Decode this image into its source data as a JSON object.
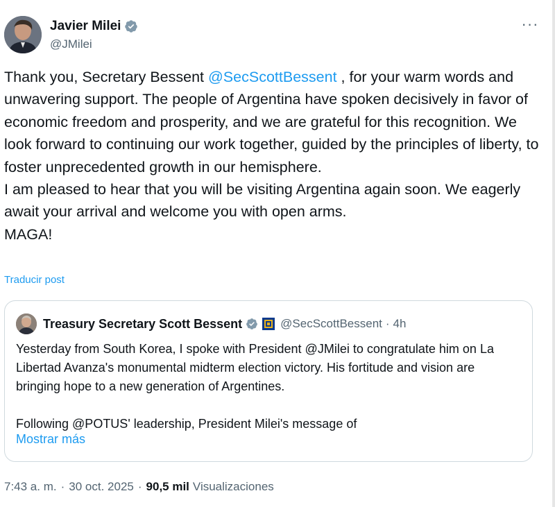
{
  "post": {
    "author": {
      "name": "Javier Milei",
      "handle": "@JMilei"
    },
    "more_icon_glyph": "···",
    "text": {
      "p1_before": "Thank you, Secretary Bessent ",
      "p1_mention": "@SecScottBessent",
      "p1_after": " , for your warm words and unwavering support. The people of Argentina have spoken decisively in favor of economic freedom and prosperity, and we are grateful for this recognition. We look forward to continuing our work together, guided by the principles of liberty, to foster unprecedented growth in our hemisphere.",
      "p2": "I am pleased to hear that you will be visiting Argentina again soon. We eagerly await your arrival and welcome you with open arms.",
      "p3": "MAGA!"
    },
    "translate_label": "Traducir post",
    "quote": {
      "author_name": "Treasury Secretary Scott Bessent",
      "handle": "@SecScottBessent",
      "separator": "·",
      "time": "4h",
      "text_p1": "Yesterday from South Korea, I spoke with President @JMilei to congratulate him on La Libertad Avanza's monumental midterm election victory. His fortitude and vision are bringing hope to a new generation of Argentines.",
      "text_p2": "Following @POTUS' leadership, President Milei's message of",
      "show_more_label": "Mostrar más"
    },
    "meta": {
      "time": "7:43 a. m.",
      "separator": "·",
      "date": "30 oct. 2025",
      "views_count": "90,5 mil",
      "views_label": "Visualizaciones"
    }
  },
  "colors": {
    "accent": "#1d9bf0",
    "text": "#0f1419",
    "secondary": "#536471",
    "border": "#cfd9de",
    "flag_blue": "#0b3a8c",
    "flag_gold": "#e8b21c"
  },
  "icons": {
    "verified": "verified-badge-icon",
    "more": "more-options-icon",
    "treasury_flag": "treasury-flag-icon"
  }
}
